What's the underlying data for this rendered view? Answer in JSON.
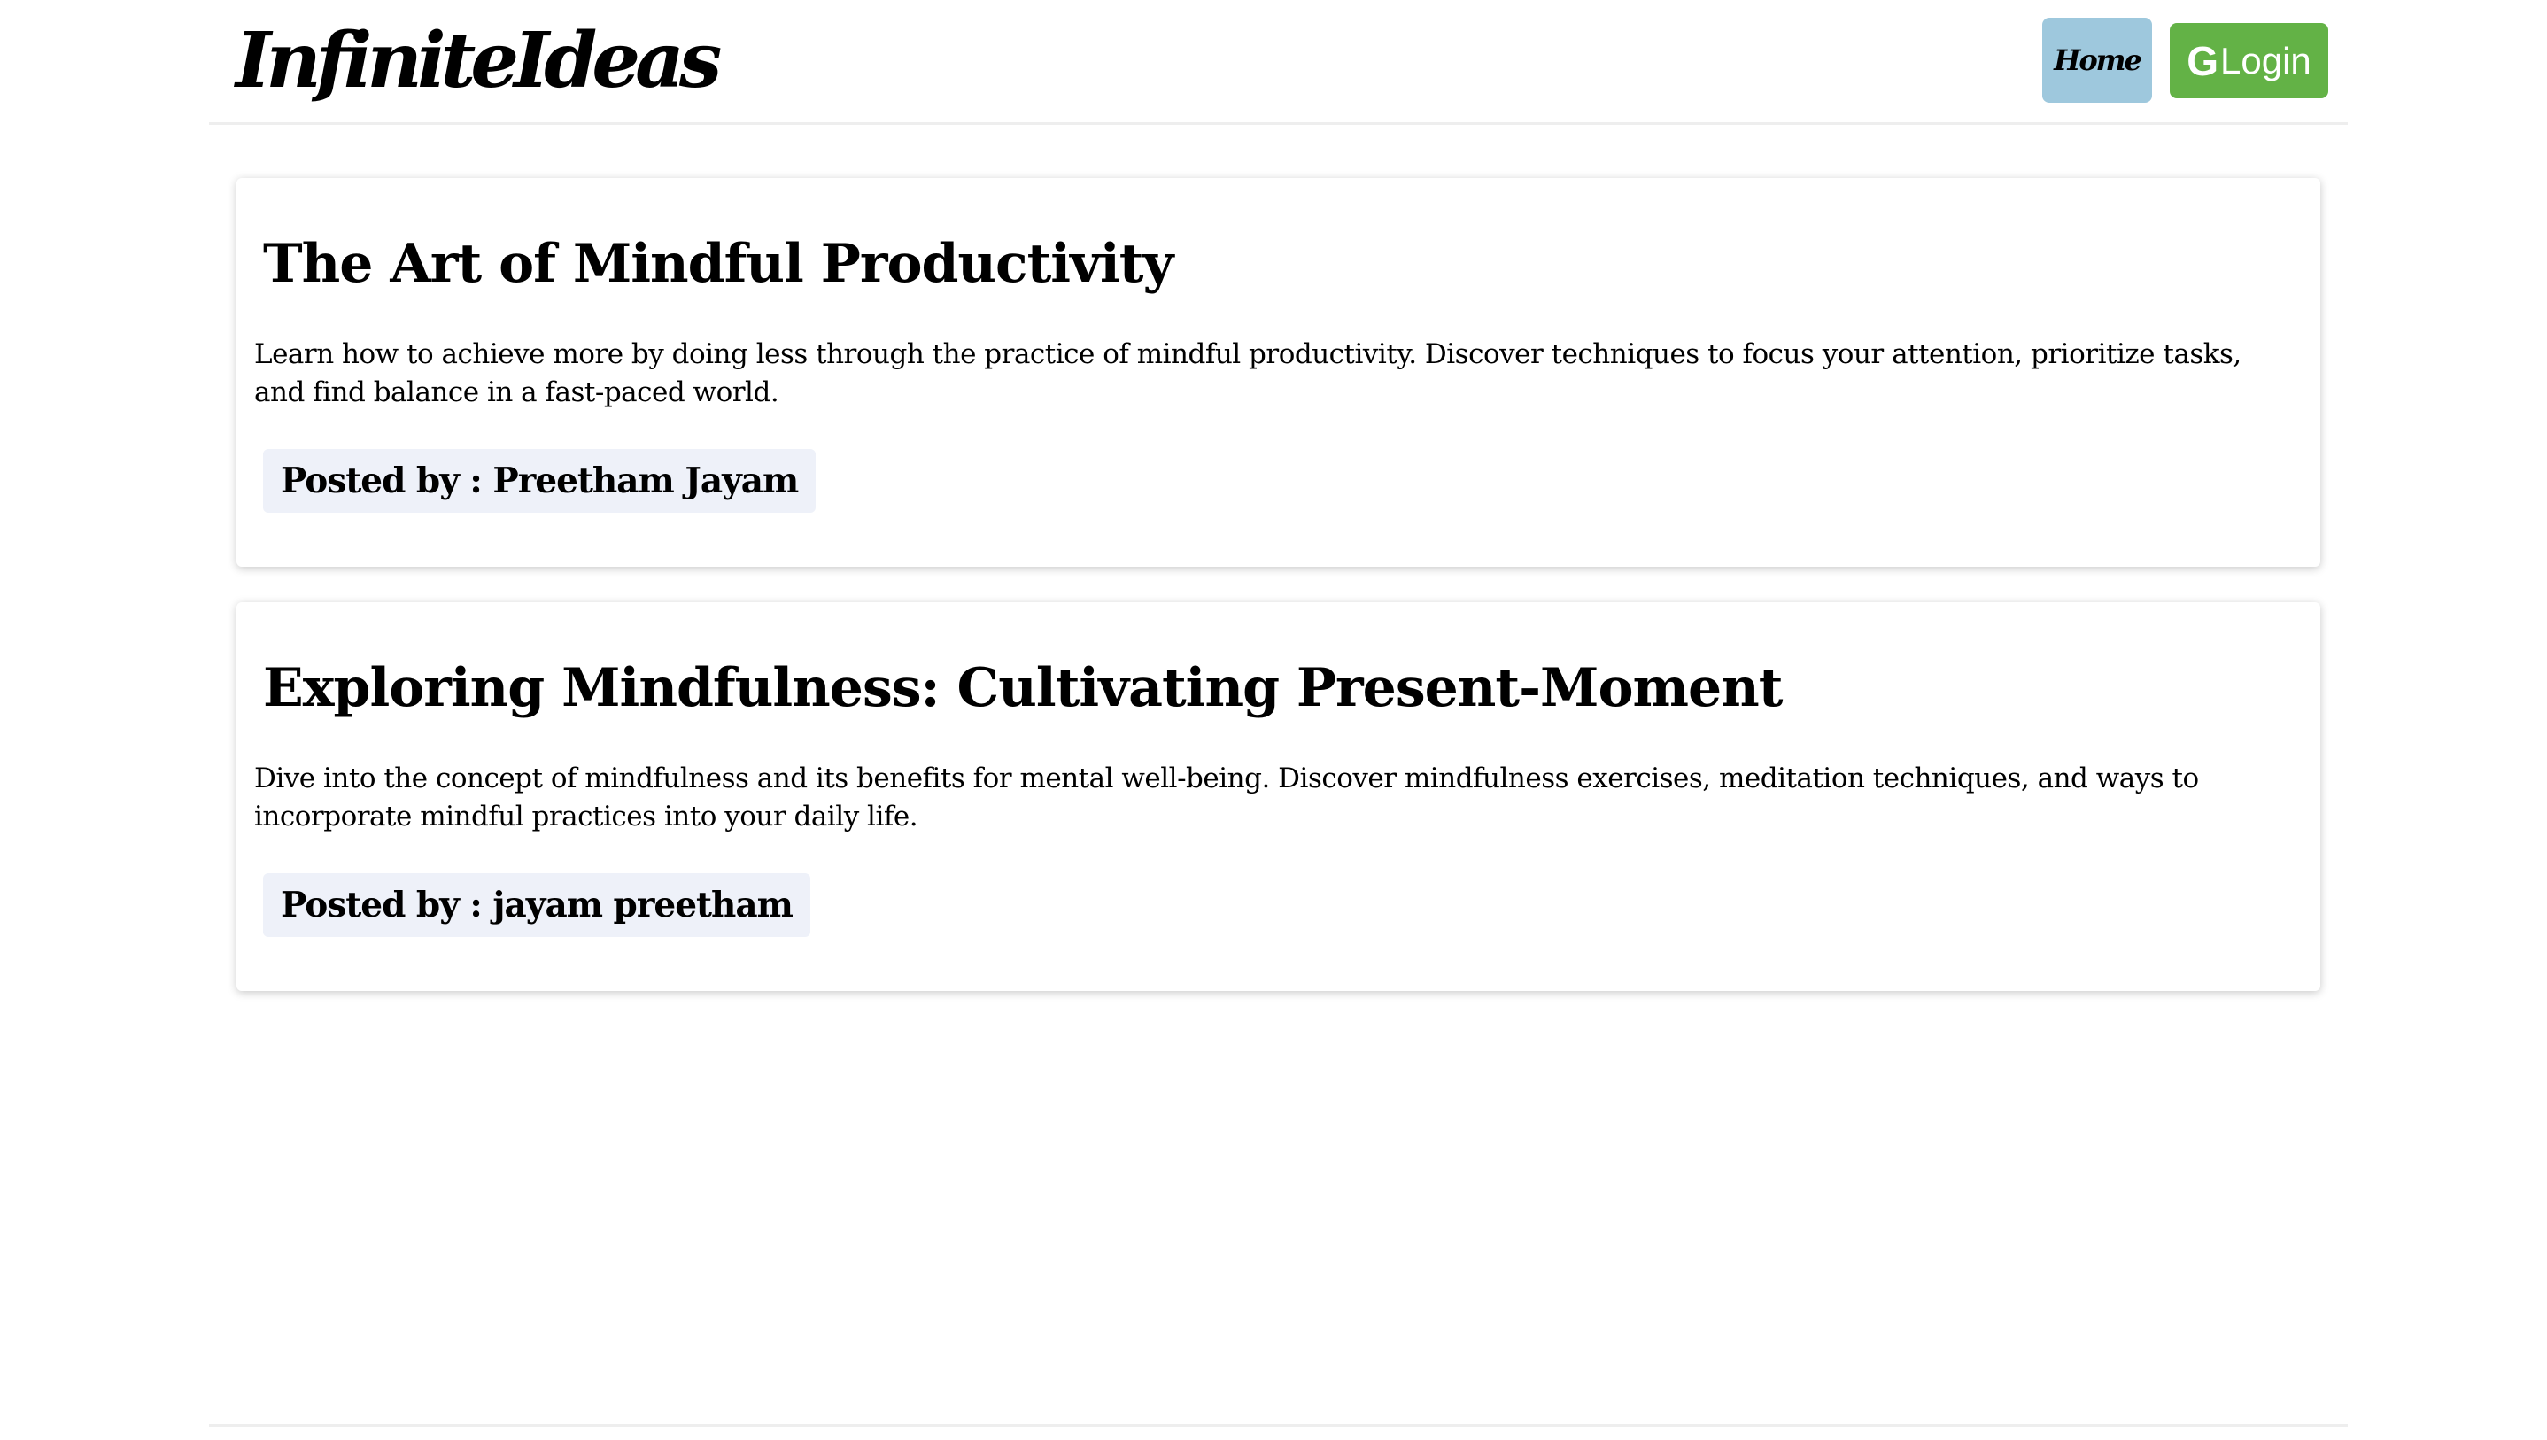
{
  "header": {
    "logo": "InfiniteIdeas",
    "home_label": "Home",
    "login_icon": "G",
    "login_label": "Login",
    "colors": {
      "home": "#9ec8dd",
      "login": "#63b246"
    }
  },
  "posts": [
    {
      "title": "The Art of Mindful Productivity",
      "description": "Learn how to achieve more by doing less through the practice of mindful productivity. Discover techniques to focus your attention, prioritize tasks, and find balance in a fast-paced world.",
      "posted_by": "Posted by : Preetham Jayam"
    },
    {
      "title": "Exploring Mindfulness: Cultivating Present-Moment",
      "description": "Dive into the concept of mindfulness and its benefits for mental well-being. Discover mindfulness exercises, meditation techniques, and ways to incorporate mindful practices into your daily life.",
      "posted_by": "Posted by : jayam preetham"
    }
  ]
}
